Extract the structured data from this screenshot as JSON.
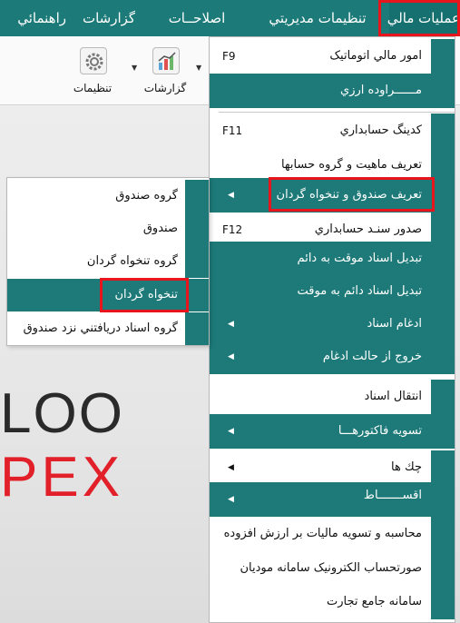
{
  "menubar": {
    "items": [
      {
        "label": "عمليات مالي"
      },
      {
        "label": "تنظيمات مديريتي"
      },
      {
        "label": "اصلاحــات"
      },
      {
        "label": "گزارشات"
      },
      {
        "label": "راهنمائي"
      }
    ]
  },
  "toolbar": {
    "reports_label": "گزارشات",
    "settings_label": "تنظيمات"
  },
  "brand": {
    "line1": "LOO",
    "line2": "PEX"
  },
  "main_menu": {
    "items": [
      {
        "label": "امور مالي اتوماتيک",
        "shortcut": "F9"
      },
      {
        "label": "مــــــراوده ارزي"
      },
      {
        "label": "کدينگ حسابداري",
        "shortcut": "F11"
      },
      {
        "label": "تعريف ماهيت و گروه حسابها"
      },
      {
        "label": "تعريف صندوق و تنخواه گردان"
      },
      {
        "label": "صدور سنـد حسابداري",
        "shortcut": "F12"
      },
      {
        "label": "تبديل اسناد موقت به دائم"
      },
      {
        "label": "تبديل اسناد دائم به موقت"
      },
      {
        "label": "ادغام اسناد"
      },
      {
        "label": "خروج از حالت ادغام"
      },
      {
        "label": "انتقال اسناد"
      },
      {
        "label": "تسويه فاکتورهـــا"
      },
      {
        "label": "چك ها"
      },
      {
        "label": "اقســـــــاط"
      },
      {
        "label": "محاسبه و تسويه ماليات بر ارزش افزوده"
      },
      {
        "label": "صورتحساب الکترونيک سامانه موديان"
      },
      {
        "label": "سامانه جامع تجارت"
      }
    ]
  },
  "sub_menu": {
    "items": [
      {
        "label": "گروه صندوق"
      },
      {
        "label": "صندوق"
      },
      {
        "label": "گروه تنخواه گردان"
      },
      {
        "label": "تنخواه گردان"
      },
      {
        "label": "گروه اسناد دريافتني نزد صندوق"
      }
    ]
  },
  "colors": {
    "menubar": "#1c7a79",
    "teal_item": "#1d7a79",
    "highlight_box": "#e8161c",
    "brand_red": "#e2202a"
  }
}
